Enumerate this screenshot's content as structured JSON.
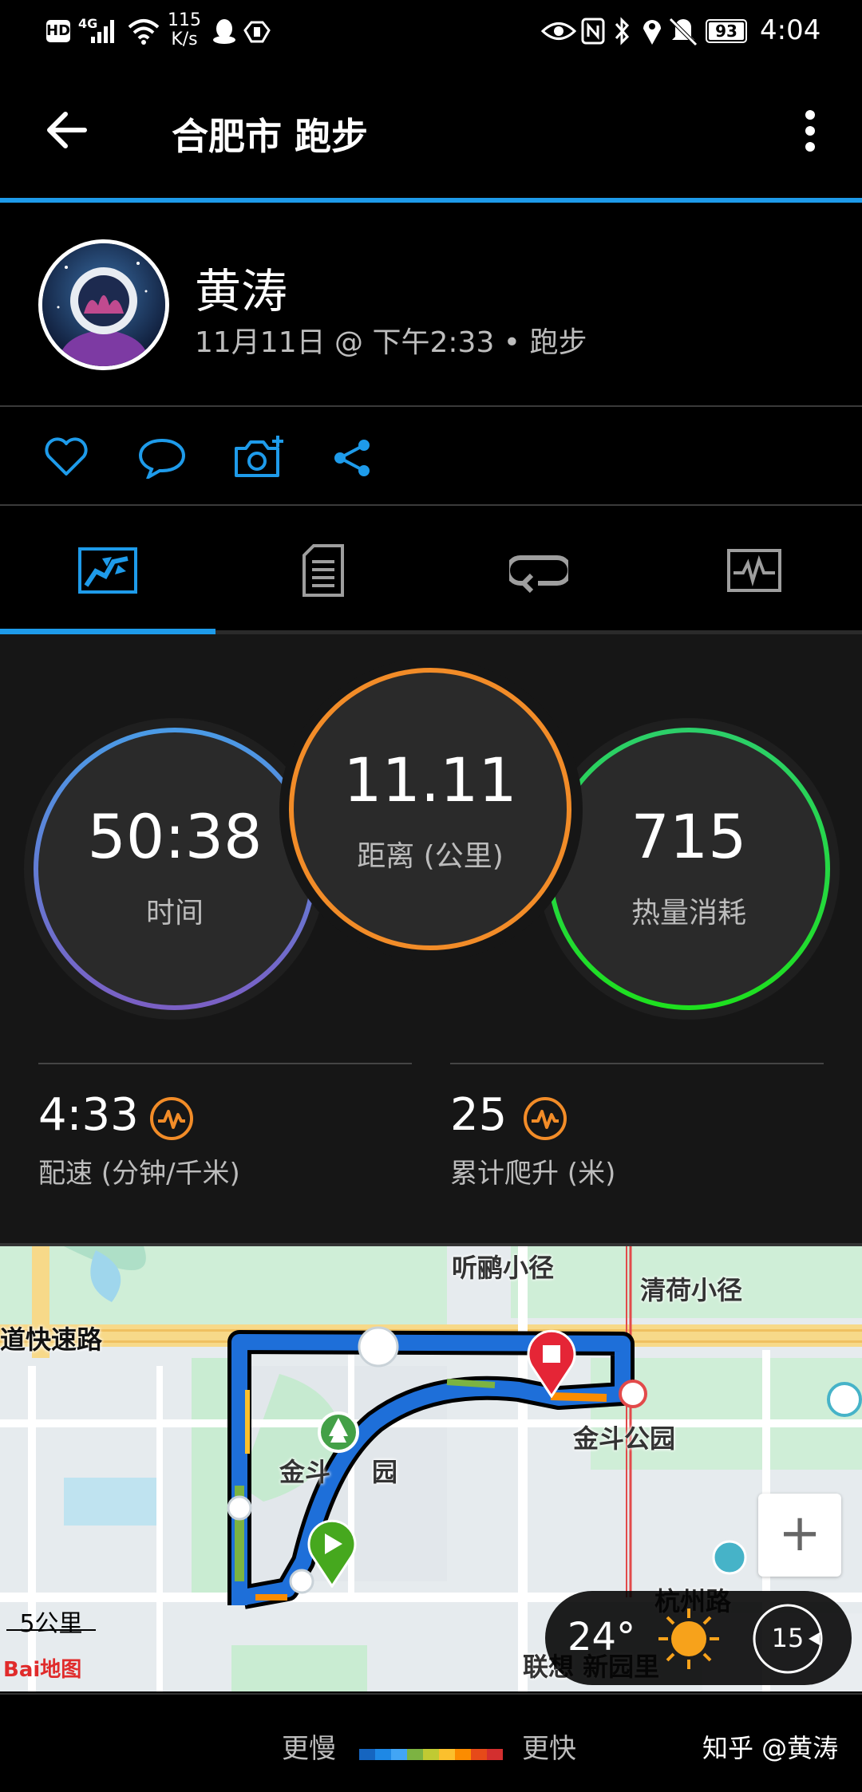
{
  "status_bar": {
    "left_badges": [
      "HD",
      "4G"
    ],
    "net_speed_value": "115",
    "net_speed_unit": "K/s",
    "battery": "93",
    "time": "4:04"
  },
  "app_bar": {
    "title": "合肥市 跑步"
  },
  "profile": {
    "name": "黄涛",
    "meta": "11月11日 @ 下午2:33 • 跑步"
  },
  "actions": [
    "like-icon",
    "comment-icon",
    "camera-icon",
    "share-icon"
  ],
  "tabs": [
    {
      "icon": "overview-map-icon",
      "active": true
    },
    {
      "icon": "details-document-icon",
      "active": false
    },
    {
      "icon": "laps-loop-icon",
      "active": false
    },
    {
      "icon": "charts-icon",
      "active": false
    }
  ],
  "stats": {
    "time": {
      "value": "50:38",
      "label": "时间"
    },
    "distance": {
      "value": "11.11",
      "label": "距离 (公里)"
    },
    "calories": {
      "value": "715",
      "label": "热量消耗"
    },
    "pace": {
      "value": "4:33",
      "label": "配速 (分钟/千米)"
    },
    "ascent": {
      "value": "25",
      "label": "累计爬升 (米)"
    }
  },
  "map": {
    "labels": {
      "road1": "道快速路",
      "path1": "听鹂小径",
      "path2": "清荷小径",
      "park": "金斗公园",
      "park_area_left": "金斗",
      "park_area_right": "园",
      "road2": "杭州路",
      "poi_bottom": "联想  新园里"
    },
    "scale": "5公里",
    "logo": "Bai地图",
    "zoom_in": "+",
    "weather": {
      "temp": "24°",
      "wind": "15"
    }
  },
  "legend": {
    "slower": "更慢",
    "faster": "更快",
    "colors": [
      "#1565c0",
      "#1e88e5",
      "#42a5f5",
      "#7cb342",
      "#c0ca33",
      "#fbc02d",
      "#fb8c00",
      "#e64a19",
      "#d32f2f"
    ],
    "watermark": "知乎 @黄涛"
  },
  "colors": {
    "accent": "#1e9bea",
    "time_ring": "#4a90e2",
    "distance_ring": "#f28c28",
    "calories_ring": "#22c55e"
  }
}
